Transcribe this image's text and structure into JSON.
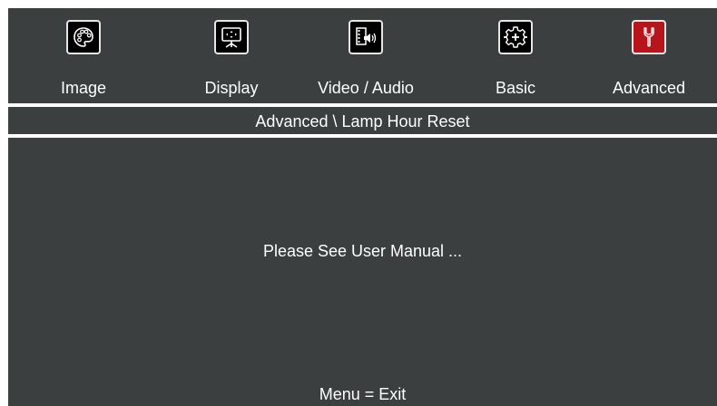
{
  "tabs": [
    {
      "label": "Image",
      "icon": "palette-icon",
      "active": false
    },
    {
      "label": "Display",
      "icon": "projection-screen-icon",
      "active": false
    },
    {
      "label": "Video / Audio",
      "icon": "film-speaker-icon",
      "active": false
    },
    {
      "label": "Basic",
      "icon": "gear-icon",
      "active": false
    },
    {
      "label": "Advanced",
      "icon": "wrench-icon",
      "active": true
    }
  ],
  "breadcrumb": "Advanced \\ Lamp Hour Reset",
  "message": "Please See User Manual ...",
  "footer": "Menu = Exit",
  "colors": {
    "background": "#3b3f40",
    "active_tab": "#b8141c",
    "text": "#ffffff"
  }
}
